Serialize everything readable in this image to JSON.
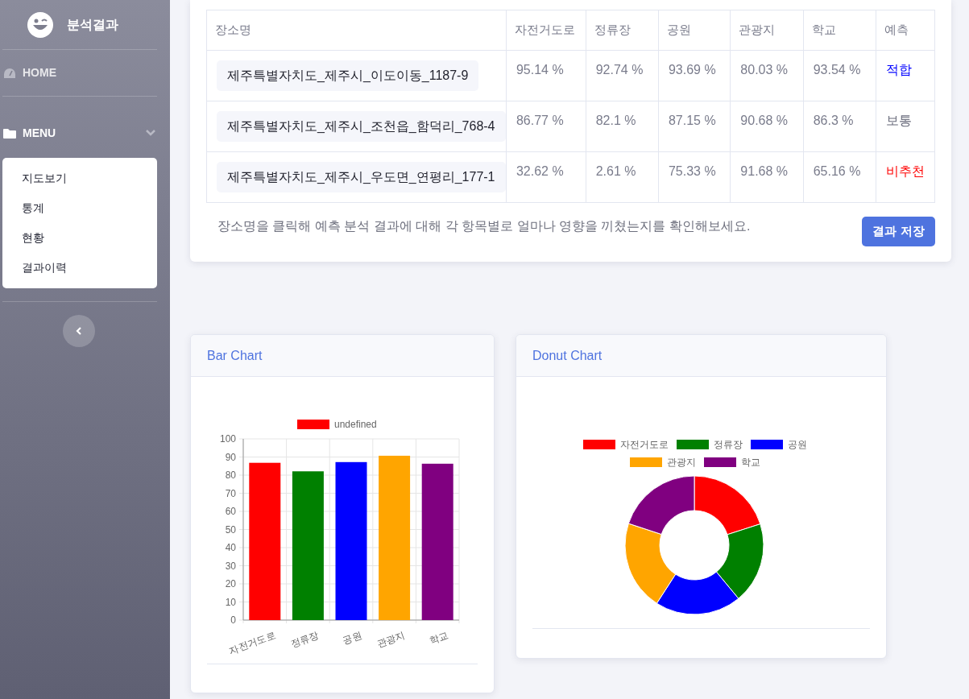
{
  "sidebar": {
    "brand": "분석결과",
    "home": "HOME",
    "menu": {
      "label": "MENU",
      "expanded": true,
      "items": [
        "지도보기",
        "통계",
        "현황",
        "결과이력"
      ]
    }
  },
  "table": {
    "columns": [
      "장소명",
      "자전거도로",
      "정류장",
      "공원",
      "관광지",
      "학교",
      "예측"
    ],
    "rows": [
      {
        "place": "제주특별자치도_제주시_이도이동_1187-9",
        "values": [
          "95.14 %",
          "92.74 %",
          "93.69 %",
          "80.03 %",
          "93.54 %"
        ],
        "prediction": {
          "text": "적합",
          "color": "#0000ff"
        }
      },
      {
        "place": "제주특별자치도_제주시_조천읍_함덕리_768-4",
        "values": [
          "86.77 %",
          "82.1 %",
          "87.15 %",
          "90.68 %",
          "86.3 %"
        ],
        "prediction": {
          "text": "보통",
          "color": "#6b6d7d"
        }
      },
      {
        "place": "제주특별자치도_제주시_우도면_연평리_177-1",
        "values": [
          "32.62 %",
          "2.61 %",
          "75.33 %",
          "91.68 %",
          "65.16 %"
        ],
        "prediction": {
          "text": "비추천",
          "color": "#ff0000"
        }
      }
    ]
  },
  "note": "장소명을 클릭해 예측 분석 결과에 대해 각 항목별로 얼마나 영향을 끼쳤는지를 확인해보세요.",
  "save_button": "결과 저장",
  "bar_card": {
    "title": "Bar Chart",
    "chart_data": {
      "type": "bar",
      "categories": [
        "자전거도로",
        "정류장",
        "공원",
        "관광지",
        "학교"
      ],
      "series": [
        {
          "name": "undefined",
          "values": [
            86.8,
            82.1,
            87.2,
            90.7,
            86.3
          ]
        }
      ],
      "colors": [
        "#ff0000",
        "#008000",
        "#0000ff",
        "#ffa500",
        "#800080"
      ],
      "ylim": [
        0,
        100
      ],
      "yticks": [
        0,
        10,
        20,
        30,
        40,
        50,
        60,
        70,
        80,
        90,
        100
      ],
      "grid": true,
      "legend": true
    }
  },
  "donut_card": {
    "title": "Donut Chart",
    "chart_data": {
      "type": "donut",
      "categories": [
        "자전거도로",
        "정류장",
        "공원",
        "관광지",
        "학교"
      ],
      "values": [
        20.04,
        18.96,
        20.13,
        20.94,
        19.93
      ],
      "colors": [
        "#ff0000",
        "#008000",
        "#0000ff",
        "#ffa500",
        "#800080"
      ],
      "legend": true
    }
  }
}
